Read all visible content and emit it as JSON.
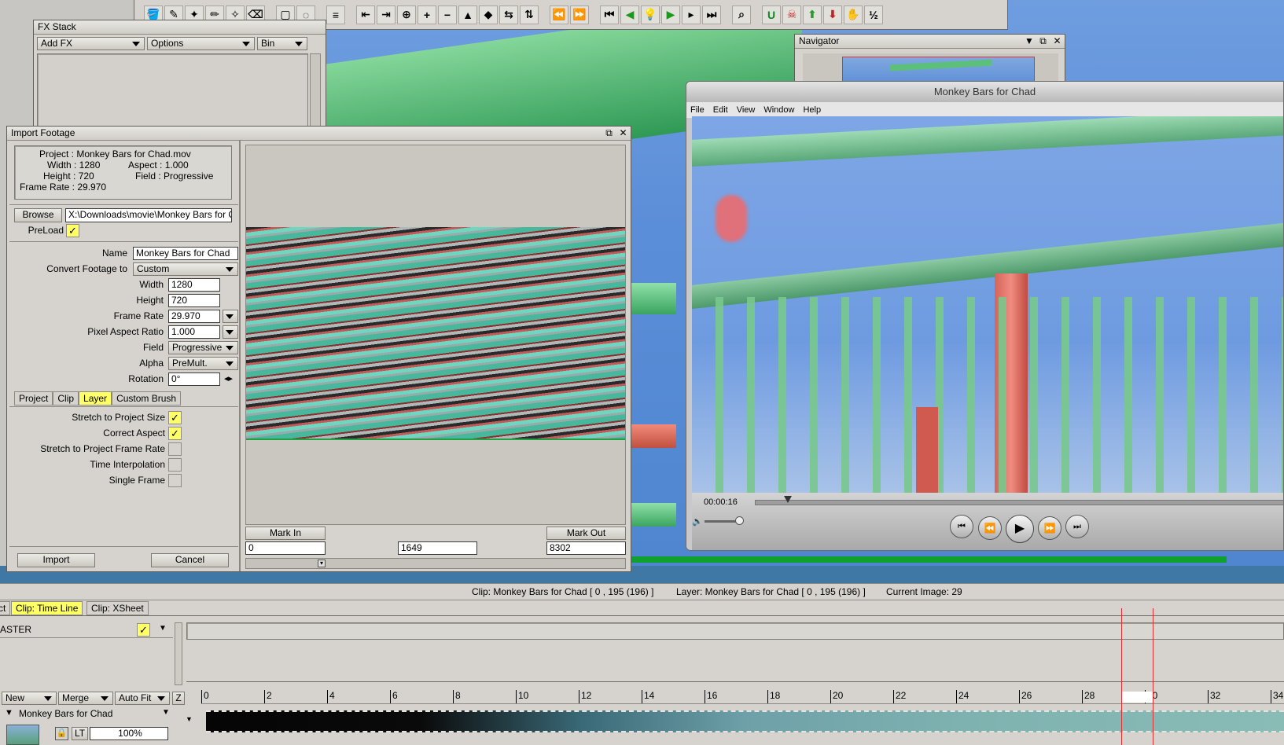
{
  "toolbar": {
    "tools": [
      "paint-bucket",
      "brush",
      "smear",
      "pencil",
      "stamp",
      "eraser",
      "rect-select",
      "lasso",
      "layers",
      "frame-prev",
      "frame-next",
      "onion",
      "frame-add",
      "frame-remove",
      "key",
      "keyframe",
      "key-link",
      "key-nav",
      "rewind-all",
      "ffwd-all",
      "first-frame",
      "step-back",
      "bulb",
      "play",
      "step-forward",
      "last-frame",
      "zoom",
      "magnet",
      "skull",
      "upload",
      "download",
      "hand",
      "half"
    ]
  },
  "fx_stack": {
    "title": "FX Stack",
    "add_fx": "Add FX",
    "options": "Options",
    "bin": "Bin"
  },
  "navigator": {
    "title": "Navigator"
  },
  "player": {
    "title": "Monkey Bars for Chad",
    "menu": [
      "File",
      "Edit",
      "View",
      "Window",
      "Help"
    ],
    "timecode": "00:00:16"
  },
  "import": {
    "title": "Import Footage",
    "info": {
      "project": "Project : Monkey Bars for Chad.mov",
      "width": "Width : 1280",
      "aspect": "Aspect : 1.000",
      "height": "Height : 720",
      "field": "Field : Progressive",
      "frame_rate": "Frame Rate : 29.970"
    },
    "browse_label": "Browse",
    "path": "X:\\Downloads\\movie\\Monkey Bars for C",
    "preload_label": "PreLoad",
    "name_label": "Name",
    "name_value": "Monkey Bars for Chad",
    "convert_label": "Convert Footage to",
    "convert_value": "Custom",
    "width_label": "Width",
    "width_value": "1280",
    "height_label": "Height",
    "height_value": "720",
    "framerate_label": "Frame Rate",
    "framerate_value": "29.970",
    "par_label": "Pixel Aspect Ratio",
    "par_value": "1.000",
    "field_label": "Field",
    "field_value": "Progressive",
    "alpha_label": "Alpha",
    "alpha_value": "PreMult.",
    "rotation_label": "Rotation",
    "rotation_value": "0°",
    "tabs": [
      "Project",
      "Clip",
      "Layer",
      "Custom Brush"
    ],
    "options": [
      {
        "label": "Stretch to Project Size",
        "checked": true
      },
      {
        "label": "Correct Aspect",
        "checked": true
      },
      {
        "label": "Stretch to Project Frame Rate",
        "checked": false
      },
      {
        "label": "Time Interpolation",
        "checked": false
      },
      {
        "label": "Single Frame",
        "checked": false
      }
    ],
    "mark_in_label": "Mark In",
    "mark_out_label": "Mark Out",
    "mark_in_value": "0",
    "mark_mid_value": "1649",
    "mark_out_value": "8302",
    "import_label": "Import",
    "cancel_label": "Cancel"
  },
  "status": {
    "clip": "Clip: Monkey Bars for Chad [ 0 , 195  (196) ]",
    "layer": "Layer: Monkey Bars for Chad [ 0 , 195  (196) ]",
    "current": "Current Image: 29"
  },
  "tabs": {
    "project_partial": "ct",
    "timeline": "Clip: Time Line",
    "xsheet": "Clip: XSheet"
  },
  "timeline": {
    "master_label": "ASTER",
    "new_label": "New",
    "merge_label": "Merge",
    "autofit_label": "Auto Fit",
    "z_label": "Z",
    "layer_name": "Monkey Bars for Chad",
    "lt_label": "LT",
    "opacity": "100%",
    "ruler": [
      "0",
      "2",
      "4",
      "6",
      "8",
      "10",
      "12",
      "14",
      "16",
      "18",
      "20",
      "22",
      "24",
      "26",
      "28",
      "30",
      "32",
      "34"
    ],
    "current_frame": 29
  }
}
